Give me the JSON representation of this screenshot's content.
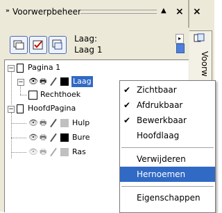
{
  "docker": {
    "title": "Voorwerpbeheer",
    "title_arrows": "»",
    "menu_arrow": "▲",
    "close_glyph": "×",
    "side_tab_label": "Voorw"
  },
  "layer_info": {
    "label": "Laag:",
    "name": "Laag 1"
  },
  "tree": {
    "items": [
      {
        "label": "Pagina 1",
        "expander": "−"
      },
      {
        "label": "Laag",
        "expander": "−"
      },
      {
        "label": "Rechthoek"
      },
      {
        "label": "HoofdPagina",
        "expander": "−"
      },
      {
        "label": "Hulp"
      },
      {
        "label": "Bure"
      },
      {
        "label": "Ras"
      }
    ]
  },
  "context_menu": {
    "items": [
      {
        "label": "Zichtbaar",
        "checked": "✔"
      },
      {
        "label": "Afdrukbaar",
        "checked": "✔"
      },
      {
        "label": "Bewerkbaar",
        "checked": "✔"
      },
      {
        "label": "Hoofdlaag",
        "checked": ""
      },
      {
        "label": "Verwijderen",
        "checked": ""
      },
      {
        "label": "Hernoemen",
        "checked": ""
      },
      {
        "label": "Eigenschappen",
        "checked": ""
      }
    ]
  },
  "colors": {
    "highlight": "#316ac5",
    "panel_bg": "#ece9d8",
    "swatch_black": "#000000",
    "swatch_gray": "#c0c0c0"
  }
}
